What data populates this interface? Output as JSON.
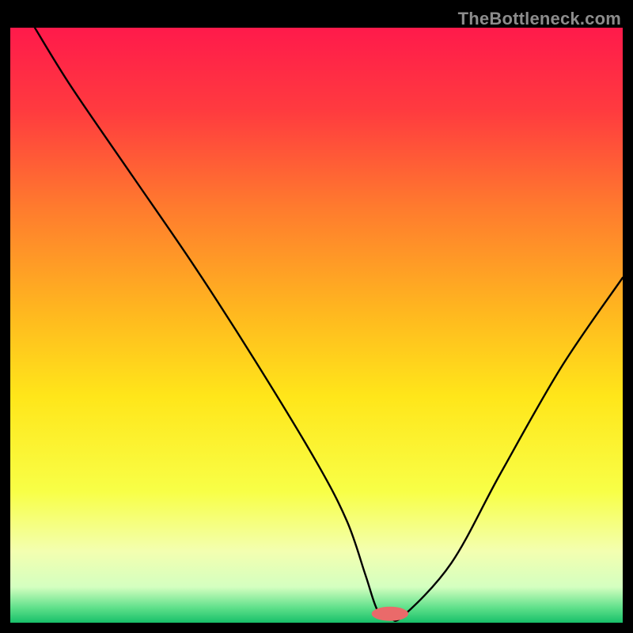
{
  "watermark": "TheBottleneck.com",
  "chart_data": {
    "type": "line",
    "title": "",
    "xlabel": "",
    "ylabel": "",
    "xlim": [
      0,
      100
    ],
    "ylim": [
      0,
      100
    ],
    "x": [
      4,
      10,
      20,
      30,
      40,
      50,
      55,
      58,
      60,
      62,
      64,
      72,
      80,
      90,
      100
    ],
    "values": [
      100,
      90,
      75,
      60,
      44,
      27,
      17,
      8,
      2,
      1,
      1,
      10,
      25,
      43,
      58
    ],
    "gradient_stops": [
      {
        "offset": 0.0,
        "color": "#ff1a4b"
      },
      {
        "offset": 0.14,
        "color": "#ff3b3f"
      },
      {
        "offset": 0.3,
        "color": "#ff7a2e"
      },
      {
        "offset": 0.48,
        "color": "#ffb81f"
      },
      {
        "offset": 0.62,
        "color": "#ffe61a"
      },
      {
        "offset": 0.78,
        "color": "#f8ff47"
      },
      {
        "offset": 0.88,
        "color": "#f3ffb0"
      },
      {
        "offset": 0.94,
        "color": "#d4ffc0"
      },
      {
        "offset": 0.975,
        "color": "#5fe08a"
      },
      {
        "offset": 1.0,
        "color": "#18c06a"
      }
    ],
    "marker": {
      "x": 62,
      "y": 1.5,
      "rx": 3.0,
      "ry": 1.2,
      "color": "#ea6a6a"
    }
  }
}
